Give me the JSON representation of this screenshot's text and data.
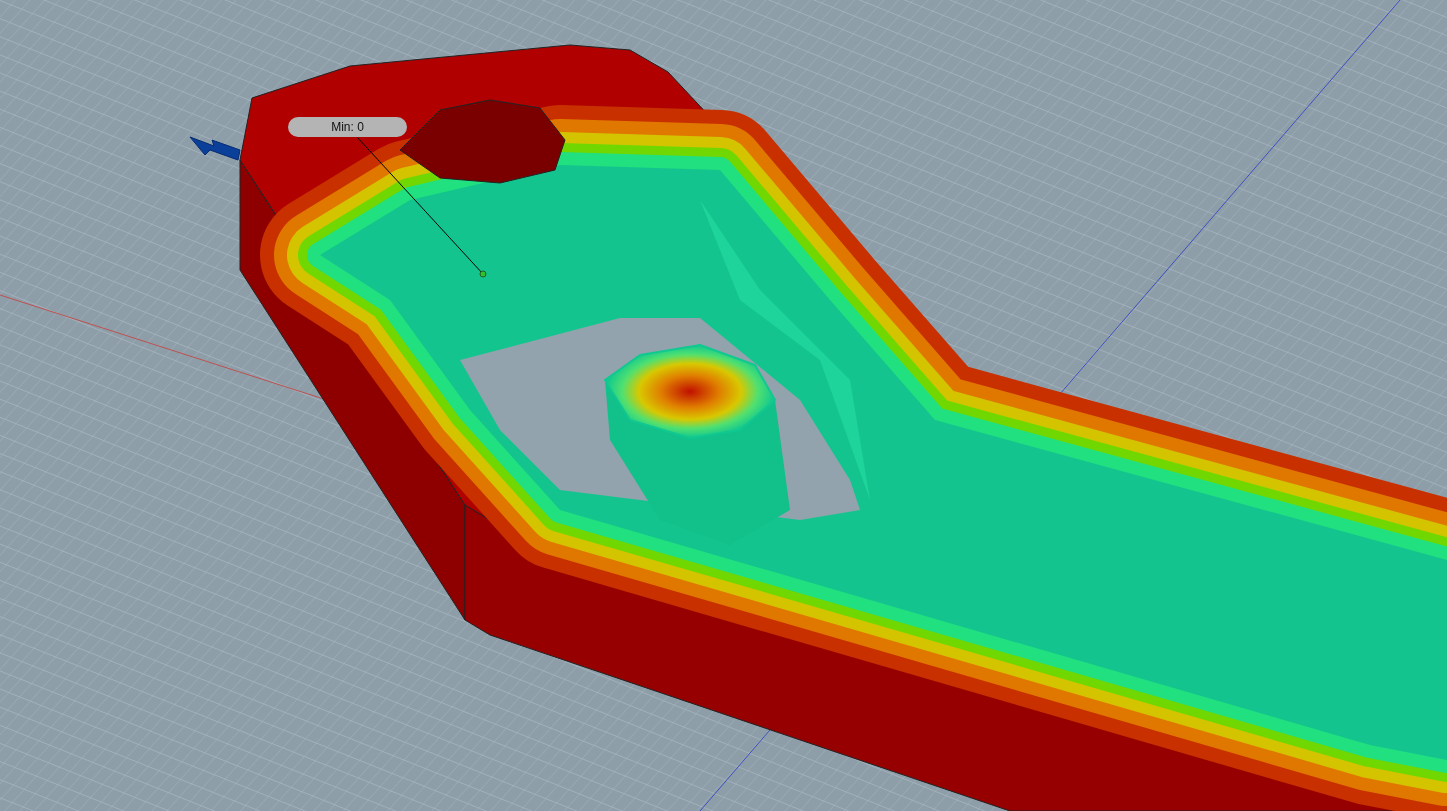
{
  "viewport": {
    "annotation": {
      "label": "Min: 0"
    }
  }
}
